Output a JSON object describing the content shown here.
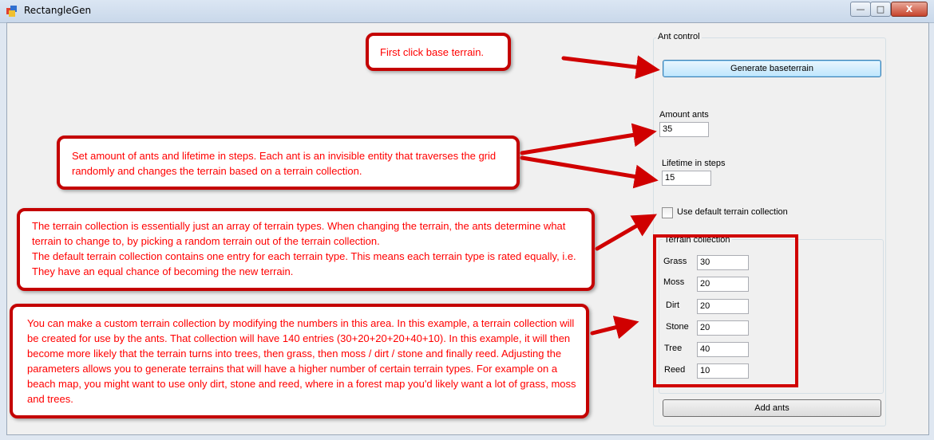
{
  "window": {
    "title": "RectangleGen",
    "minimize": "—",
    "maximize": "□",
    "close": "X"
  },
  "ant_control": {
    "group_label": "Ant control",
    "generate_label": "Generate baseterrain",
    "amount_label": "Amount ants",
    "amount_value": "35",
    "lifetime_label": "Lifetime in steps",
    "lifetime_value": "15",
    "default_collection_label": "Use default terrain collection",
    "default_collection_checked": false,
    "add_ants_label": "Add ants"
  },
  "terrain_collection": {
    "group_label": "Terrain collection",
    "items": [
      {
        "label": "Grass",
        "value": "30"
      },
      {
        "label": "Moss",
        "value": "20"
      },
      {
        "label": "Dirt",
        "value": "20"
      },
      {
        "label": "Stone",
        "value": "20"
      },
      {
        "label": "Tree",
        "value": "40"
      },
      {
        "label": "Reed",
        "value": "10"
      }
    ]
  },
  "callouts": {
    "base_terrain": "First click base terrain.",
    "ants": "Set amount of ants and lifetime in steps. Each ant is an invisible entity that traverses the grid randomly and changes the terrain based on a terrain collection.",
    "collection_intro": "The terrain collection is essentially just an array of terrain types. When changing the terrain, the ants determine what terrain to change to, by picking a random terrain out of the terrain collection.",
    "collection_default": "The default terrain collection contains one entry for each terrain type. This means each terrain type is rated equally, i.e. They have an equal chance of becoming the new terrain.",
    "custom": "You can make a custom terrain collection by modifying the numbers in this area. In this example, a terrain collection will be created for use by the ants. That collection will have 140 entries (30+20+20+20+40+10). In this example, it will then become more likely that the terrain turns into trees, then grass, then moss / dirt / stone and finally reed. Adjusting the parameters allows you to generate terrains that will have a higher number of certain terrain types. For example on a beach map, you might want to use only dirt, stone and reed, where in a forest map you'd likely want a lot of grass, moss and trees."
  },
  "colors": {
    "annotation_red": "#ff0000",
    "annotation_border": "#c40000"
  }
}
